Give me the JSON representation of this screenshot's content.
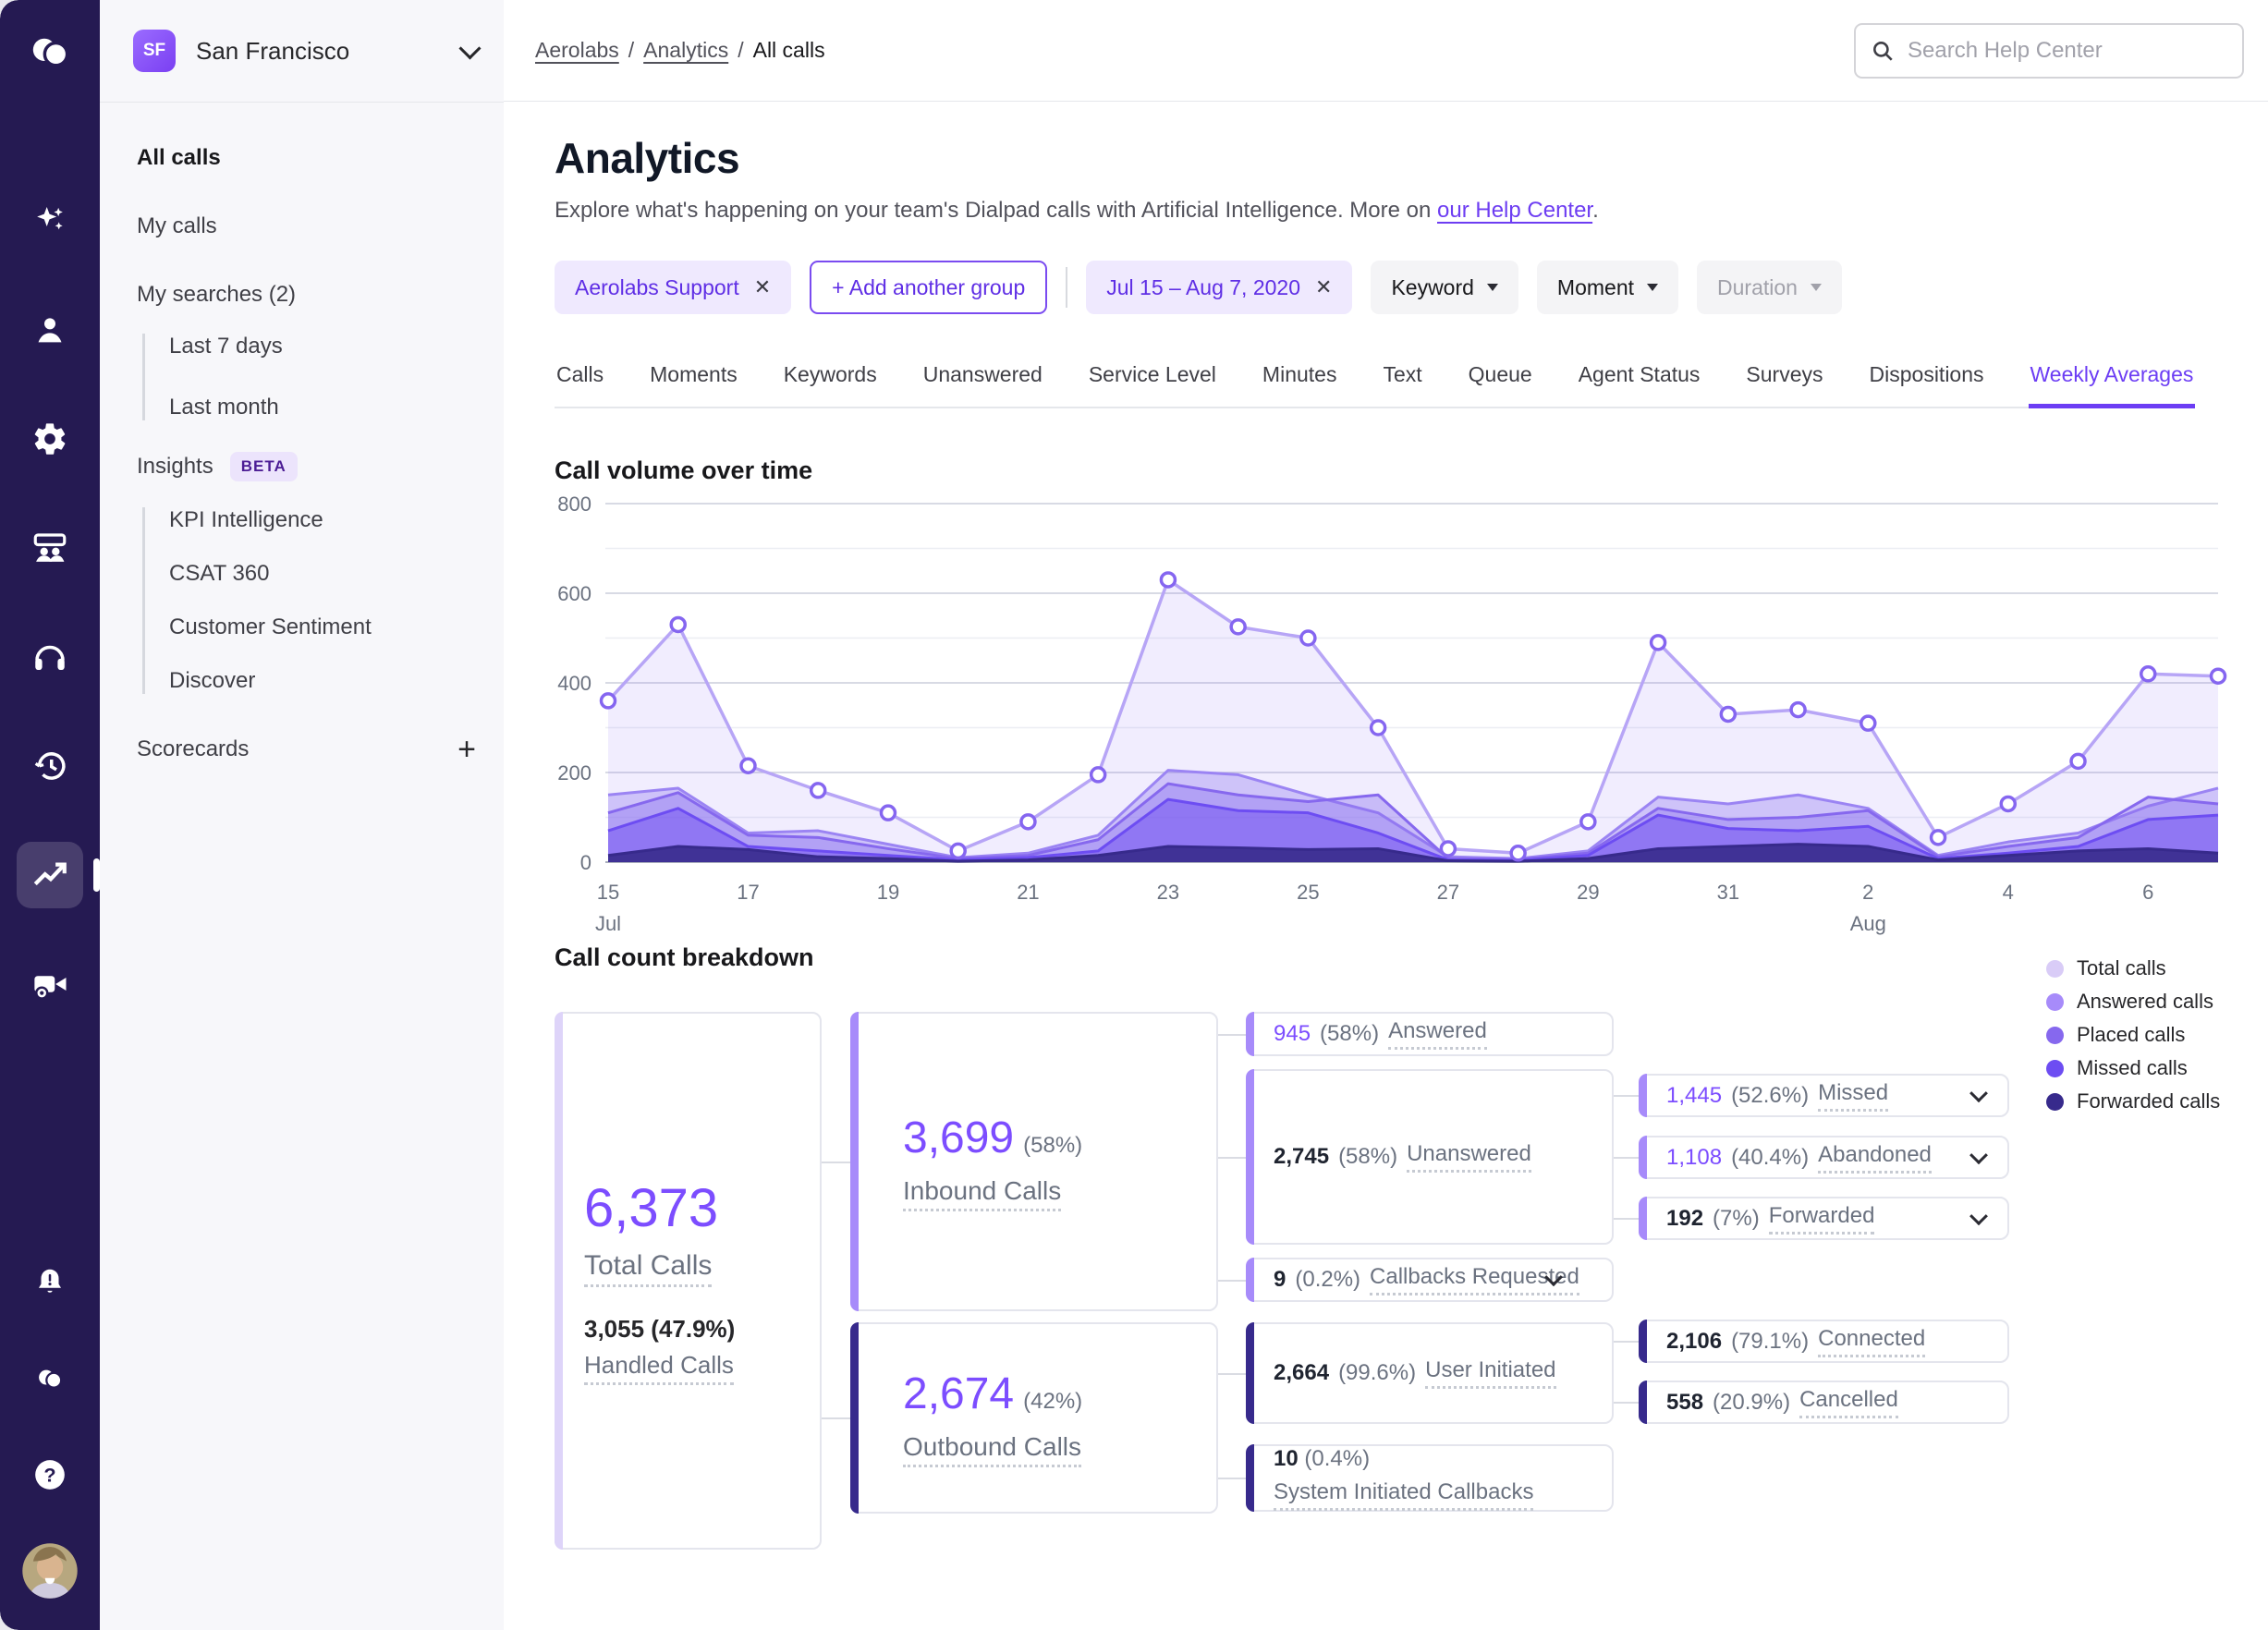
{
  "rail": {
    "icons": [
      "dialpad-logo",
      "sparkles",
      "person",
      "gear",
      "team",
      "headset",
      "history",
      "trending",
      "video-settings"
    ],
    "bottom_icons": [
      "bell-alert",
      "dialpad-mini",
      "help",
      "avatar"
    ],
    "active_icon": "trending",
    "bg_color": "#251a52"
  },
  "sidebar": {
    "org_badge": "SF",
    "org_name": "San Francisco",
    "items": {
      "all_calls": "All calls",
      "my_calls": "My calls",
      "my_searches": "My searches (2)",
      "last_7": "Last 7 days",
      "last_month": "Last month",
      "insights": "Insights",
      "beta": "BETA",
      "kpi": "KPI Intelligence",
      "csat": "CSAT 360",
      "sentiment": "Customer Sentiment",
      "discover": "Discover",
      "scorecards": "Scorecards",
      "add": "+"
    }
  },
  "header": {
    "breadcrumb": {
      "b0": "Aerolabs",
      "b1": "Analytics",
      "b2": "All calls",
      "sep": "/"
    },
    "search_placeholder": "Search Help Center"
  },
  "page": {
    "title": "Analytics",
    "desc_prefix": "Explore what's happening on your team's Dialpad calls with Artificial Intelligence. More on ",
    "desc_link": "our Help Center",
    "desc_suffix": "."
  },
  "filters": {
    "group": "Aerolabs Support",
    "group_close": "✕",
    "add_group": "+ Add another group",
    "date": "Jul 15 – Aug 7, 2020",
    "date_close": "✕",
    "keyword": "Keyword",
    "moment": "Moment",
    "duration": "Duration"
  },
  "tabs": {
    "items": [
      "Calls",
      "Moments",
      "Keywords",
      "Unanswered",
      "Service Level",
      "Minutes",
      "Text",
      "Queue",
      "Agent Status",
      "Surveys",
      "Dispositions",
      "Weekly Averages"
    ],
    "active": "Weekly Averages"
  },
  "chart_data": {
    "type": "area",
    "title": "Call volume over time",
    "xlabel": "",
    "ylabel": "",
    "ylim": [
      0,
      800
    ],
    "yticks": [
      0,
      200,
      400,
      600,
      800
    ],
    "grid": true,
    "legend_position": "right-of-breakdown",
    "categories": [
      "Jul 15",
      "Jul 16",
      "Jul 17",
      "Jul 18",
      "Jul 19",
      "Jul 20",
      "Jul 21",
      "Jul 22",
      "Jul 23",
      "Jul 24",
      "Jul 25",
      "Jul 26",
      "Jul 27",
      "Jul 28",
      "Jul 29",
      "Jul 30",
      "Jul 31",
      "Aug 1",
      "Aug 2",
      "Aug 3",
      "Aug 4",
      "Aug 5",
      "Aug 6",
      "Aug 7"
    ],
    "xticks": [
      [
        0,
        "15"
      ],
      [
        2,
        "17"
      ],
      [
        4,
        "19"
      ],
      [
        6,
        "21"
      ],
      [
        8,
        "23"
      ],
      [
        10,
        "25"
      ],
      [
        12,
        "27"
      ],
      [
        14,
        "29"
      ],
      [
        16,
        "31"
      ],
      [
        18,
        "2"
      ],
      [
        20,
        "4"
      ],
      [
        22,
        "6"
      ]
    ],
    "month_ticks": [
      [
        0,
        "Jul"
      ],
      [
        18,
        "Aug"
      ]
    ],
    "series": [
      {
        "name": "Total calls",
        "color": "#b7a5f6",
        "fill": "rgba(139,104,246,0.12)",
        "marker": true,
        "values": [
          360,
          530,
          215,
          160,
          110,
          25,
          90,
          195,
          630,
          525,
          500,
          300,
          30,
          20,
          90,
          490,
          330,
          340,
          310,
          55,
          130,
          225,
          420,
          415
        ]
      },
      {
        "name": "Answered calls",
        "color": "#9b84f3",
        "fill": "rgba(155,132,243,0.40)",
        "marker": false,
        "values": [
          150,
          165,
          65,
          70,
          40,
          10,
          20,
          60,
          205,
          195,
          150,
          110,
          12,
          8,
          25,
          145,
          130,
          150,
          120,
          15,
          45,
          65,
          125,
          165
        ]
      },
      {
        "name": "Placed calls",
        "color": "#8668ee",
        "fill": "rgba(134,104,238,0.38)",
        "marker": false,
        "values": [
          110,
          155,
          60,
          55,
          30,
          8,
          15,
          50,
          175,
          150,
          135,
          150,
          8,
          6,
          20,
          120,
          95,
          100,
          115,
          12,
          35,
          55,
          145,
          130
        ]
      },
      {
        "name": "Missed calls",
        "color": "#6d4df2",
        "fill": "rgba(109,77,242,0.50)",
        "marker": false,
        "values": [
          70,
          120,
          35,
          25,
          15,
          5,
          10,
          25,
          140,
          115,
          110,
          65,
          5,
          4,
          15,
          105,
          75,
          70,
          80,
          8,
          20,
          35,
          95,
          105
        ]
      },
      {
        "name": "Forwarded calls",
        "color": "#372a8c",
        "fill": "rgba(55,42,140,0.90)",
        "marker": false,
        "values": [
          15,
          35,
          28,
          12,
          8,
          2,
          5,
          15,
          35,
          32,
          28,
          30,
          3,
          2,
          8,
          30,
          35,
          40,
          35,
          5,
          15,
          25,
          30,
          20
        ]
      }
    ],
    "legend": [
      {
        "label": "Total calls",
        "color": "#d9ccf7"
      },
      {
        "label": "Answered calls",
        "color": "#a78bfa"
      },
      {
        "label": "Placed calls",
        "color": "#8668ee"
      },
      {
        "label": "Missed calls",
        "color": "#6d4df2"
      },
      {
        "label": "Forwarded calls",
        "color": "#372a8c"
      }
    ]
  },
  "breakdown": {
    "title": "Call count breakdown",
    "accent_light": "#a78bfa",
    "accent_dark": "#372a8c",
    "nodes": {
      "total": {
        "value": "6,373",
        "label": "Total Calls",
        "sub_value": "3,055 (47.9%)",
        "sub_label": "Handled Calls"
      },
      "inbound": {
        "value": "3,699",
        "pct": "(58%)",
        "label": "Inbound Calls"
      },
      "outbound": {
        "value": "2,674",
        "pct": "(42%)",
        "label": "Outbound Calls"
      },
      "answered": {
        "value": "945",
        "pct": "(58%)",
        "label": "Answered"
      },
      "unanswered": {
        "value": "2,745",
        "pct": "(58%)",
        "label": "Unanswered"
      },
      "callbacks": {
        "value": "9",
        "pct": "(0.2%)",
        "label": "Callbacks Requested"
      },
      "missed": {
        "value": "1,445",
        "pct": "(52.6%)",
        "label": "Missed"
      },
      "abandoned": {
        "value": "1,108",
        "pct": "(40.4%)",
        "label": "Abandoned"
      },
      "forwarded": {
        "value": "192",
        "pct": "(7%)",
        "label": "Forwarded"
      },
      "user_initiated": {
        "value": "2,664",
        "pct": "(99.6%)",
        "label": "User Initiated"
      },
      "connected": {
        "value": "2,106",
        "pct": "(79.1%)",
        "label": "Connected"
      },
      "cancelled": {
        "value": "558",
        "pct": "(20.9%)",
        "label": "Cancelled"
      },
      "system_callbacks": {
        "value": "10",
        "pct": "(0.4%)",
        "label": "System Initiated Callbacks"
      }
    }
  }
}
